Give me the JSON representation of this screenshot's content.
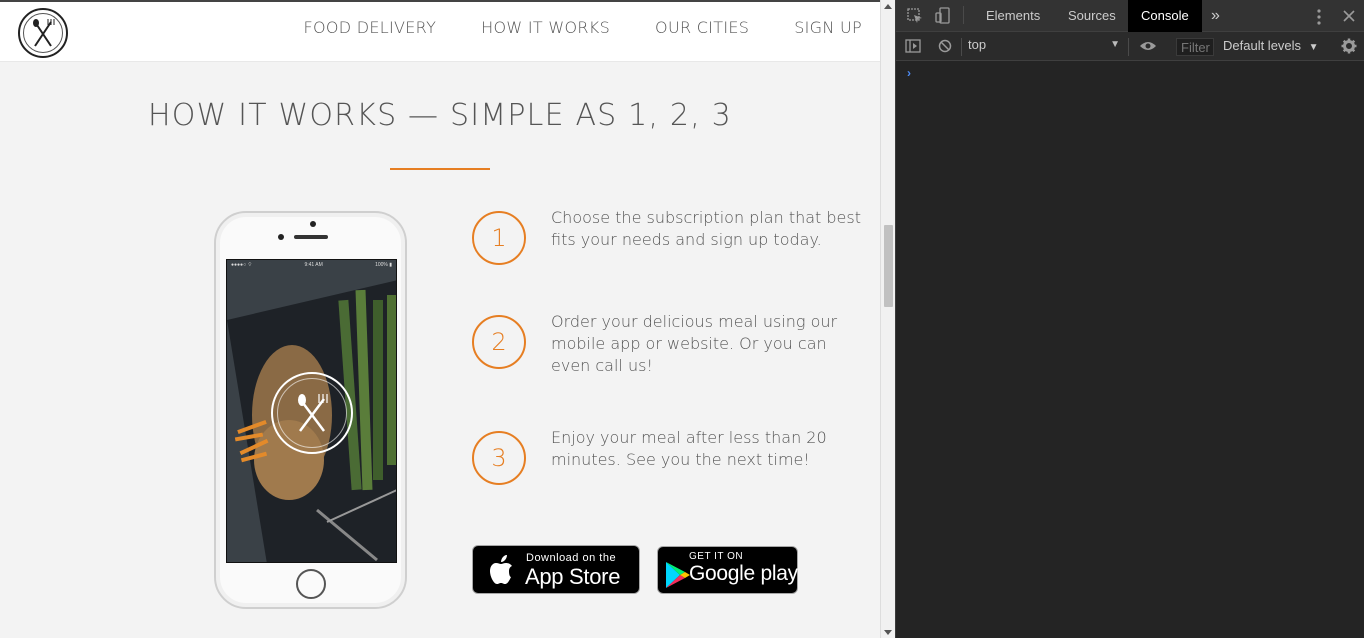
{
  "nav": {
    "items": [
      "FOOD DELIVERY",
      "HOW IT WORKS",
      "OUR CITIES",
      "SIGN UP"
    ]
  },
  "section": {
    "title": "HOW IT WORKS — SIMPLE AS 1, 2, 3"
  },
  "steps": [
    {
      "number": "1",
      "text": "Choose the subscription plan that best fits your needs and sign up today."
    },
    {
      "number": "2",
      "text": "Order your delicious meal using our mobile app or website. Or you can even call us!"
    },
    {
      "number": "3",
      "text": "Enjoy your meal after less than 20 minutes. See you the next time!"
    }
  ],
  "badges": {
    "appstore": {
      "small": "Download on the",
      "big": "App Store"
    },
    "googleplay": {
      "small": "GET IT ON",
      "big": "Google play"
    }
  },
  "colors": {
    "accent": "#e67e22",
    "text": "#555555",
    "page_bg": "#f3f3f3",
    "devtools_bg": "#242424"
  },
  "devtools": {
    "tabs": [
      "Elements",
      "Sources",
      "Console"
    ],
    "active_tab": "Console",
    "more_tabs_icon": "»",
    "context": "top",
    "filter_placeholder": "Filter",
    "levels": "Default levels",
    "prompt": "›"
  }
}
